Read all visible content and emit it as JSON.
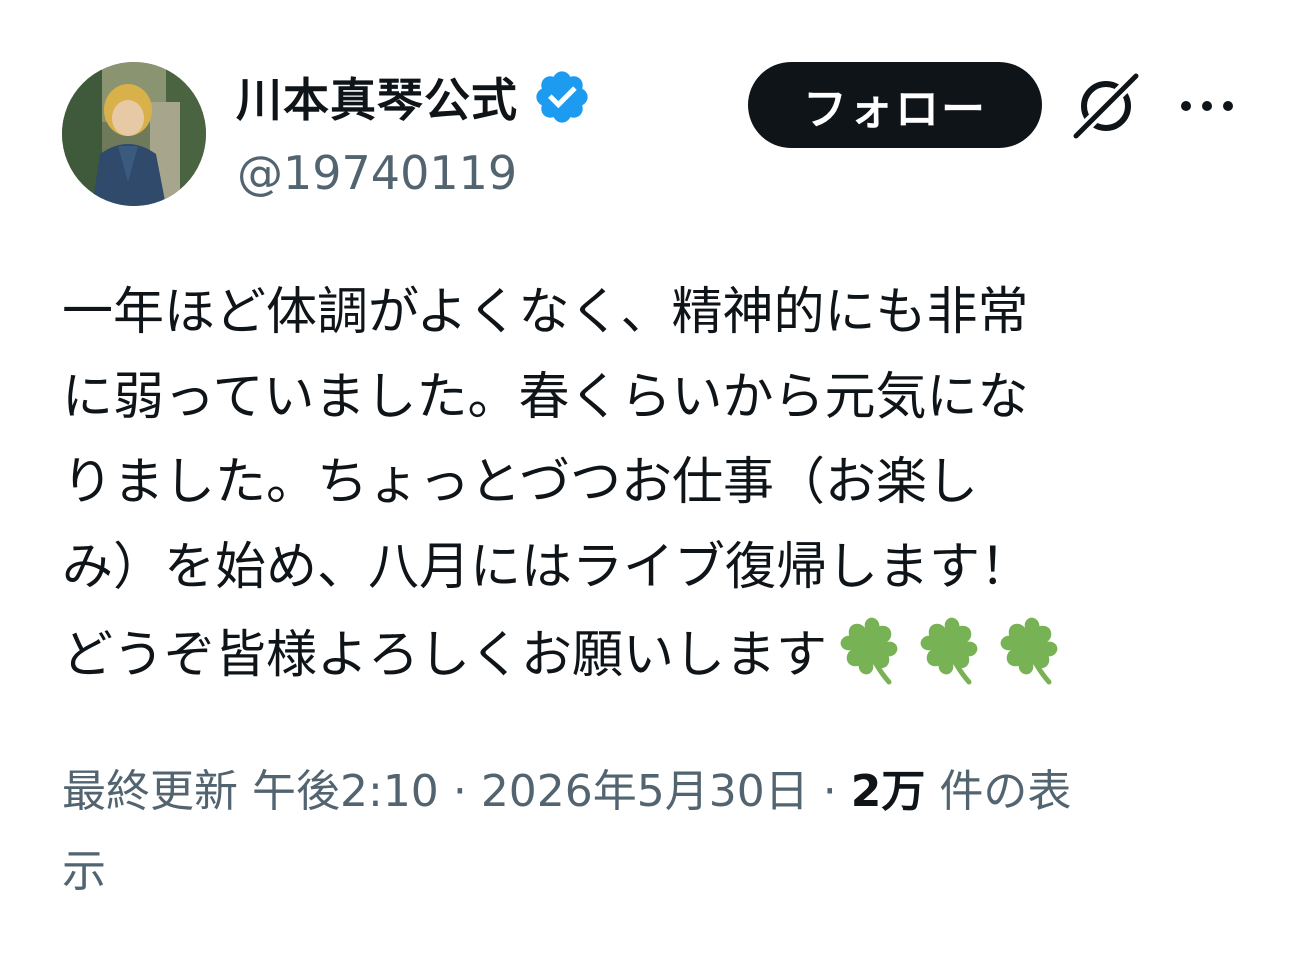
{
  "author": {
    "display_name": "川本真琴公式",
    "handle": "@19740119",
    "verified": true,
    "avatar_icon": "profile-photo"
  },
  "actions": {
    "follow_label": "フォロー",
    "grok_icon": "slashed-circle-icon",
    "more_icon": "more-horizontal-icon"
  },
  "tweet": {
    "lines": [
      "一年ほど体調がよくなく、精神的にも非常",
      "に弱っていました。春くらいから元気にな",
      "りました。ちょっとづつお仕事（お楽し",
      "み）を始め、八月にはライブ復帰します！",
      "どうぞ皆様よろしくお願いします"
    ],
    "emoji": [
      "🍀",
      "🍀",
      "🍀"
    ]
  },
  "meta": {
    "edited_label": "最終更新",
    "time": "午後2:10",
    "separator": "·",
    "date": "2026年5月30日",
    "views_count": "2万",
    "views_label_line1": "件の表",
    "views_label_line2": "示"
  },
  "colors": {
    "text_primary": "#0f1419",
    "text_secondary": "#536471",
    "verified_blue": "#1d9bf0",
    "clover_green": "#77b255"
  }
}
